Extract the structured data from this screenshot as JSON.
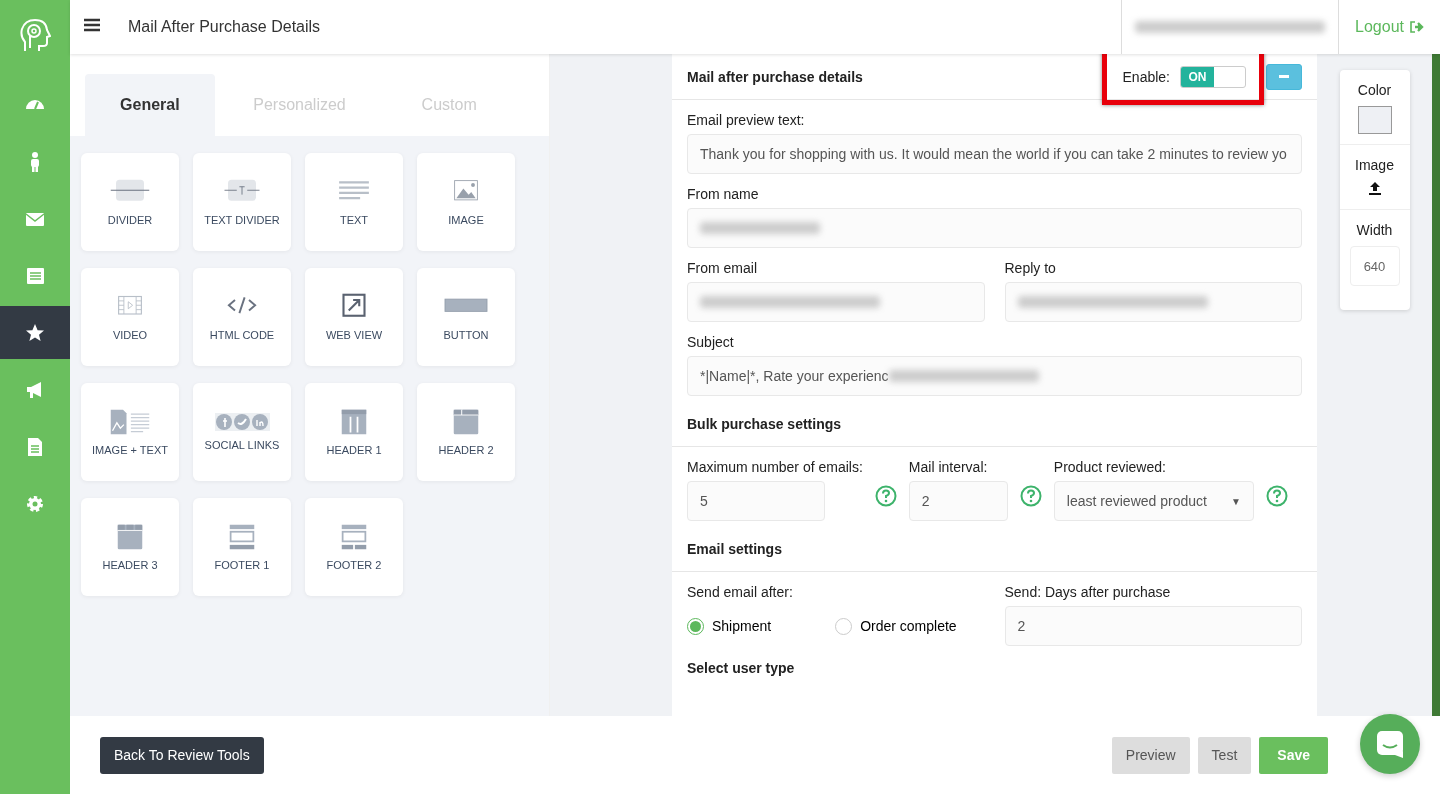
{
  "sidebar": {
    "items": [
      {
        "kind": "dashboard",
        "selected": false
      },
      {
        "kind": "person",
        "selected": false
      },
      {
        "kind": "mail",
        "selected": false
      },
      {
        "kind": "list",
        "selected": false
      },
      {
        "kind": "star",
        "selected": true
      },
      {
        "kind": "megaphone",
        "selected": false
      },
      {
        "kind": "document",
        "selected": false
      },
      {
        "kind": "gear",
        "selected": false
      }
    ]
  },
  "header": {
    "title": "Mail After Purchase Details",
    "logout": "Logout"
  },
  "tabs": [
    {
      "label": "General",
      "selected": true
    },
    {
      "label": "Personalized",
      "selected": false
    },
    {
      "label": "Custom",
      "selected": false
    }
  ],
  "blocks": [
    {
      "label": "DIVIDER",
      "kind": "divider"
    },
    {
      "label": "TEXT DIVIDER",
      "kind": "text-divider"
    },
    {
      "label": "TEXT",
      "kind": "text"
    },
    {
      "label": "IMAGE",
      "kind": "image"
    },
    {
      "label": "VIDEO",
      "kind": "video"
    },
    {
      "label": "HTML CODE",
      "kind": "code"
    },
    {
      "label": "WEB VIEW",
      "kind": "webview"
    },
    {
      "label": "BUTTON",
      "kind": "button"
    },
    {
      "label": "IMAGE + TEXT",
      "kind": "image-text"
    },
    {
      "label": "SOCIAL LINKS",
      "kind": "social"
    },
    {
      "label": "HEADER 1",
      "kind": "header1"
    },
    {
      "label": "HEADER 2",
      "kind": "header2"
    },
    {
      "label": "HEADER 3",
      "kind": "header3"
    },
    {
      "label": "FOOTER 1",
      "kind": "footer1"
    },
    {
      "label": "FOOTER 2",
      "kind": "footer2"
    }
  ],
  "form": {
    "title": "Mail after purchase details",
    "enable": {
      "label": "Enable:",
      "text": "ON",
      "on": true
    },
    "preview_text": {
      "label": "Email preview text:",
      "value": "Thank you for shopping with us. It would mean the world if you can take 2 minutes to review yo"
    },
    "from_name": {
      "label": "From name"
    },
    "from_email": {
      "label": "From email"
    },
    "reply_to": {
      "label": "Reply to"
    },
    "subject": {
      "label": "Subject",
      "value": "*|Name|*, Rate your experienc"
    },
    "bulk": {
      "title": "Bulk purchase settings",
      "max_emails": {
        "label": "Maximum number of emails:",
        "value": "5"
      },
      "interval": {
        "label": "Mail interval:",
        "value": "2"
      },
      "product": {
        "label": "Product reviewed:",
        "value": "least reviewed product",
        "caret": "▼"
      }
    },
    "email_settings": {
      "title": "Email settings",
      "send_after_label": "Send email after:",
      "options": [
        {
          "label": "Shipment",
          "selected": true
        },
        {
          "label": "Order complete",
          "selected": false
        }
      ],
      "days": {
        "label": "Send: Days after purchase",
        "value": "2"
      }
    },
    "next_section": "Select user type"
  },
  "properties": {
    "color_label": "Color",
    "image_label": "Image",
    "width_label": "Width",
    "width_value": "640"
  },
  "footer": {
    "back": "Back To Review Tools",
    "buttons": [
      {
        "label": "Preview",
        "kind": "plain"
      },
      {
        "label": "Test",
        "kind": "plain"
      },
      {
        "label": "Save",
        "kind": "primary"
      }
    ]
  }
}
